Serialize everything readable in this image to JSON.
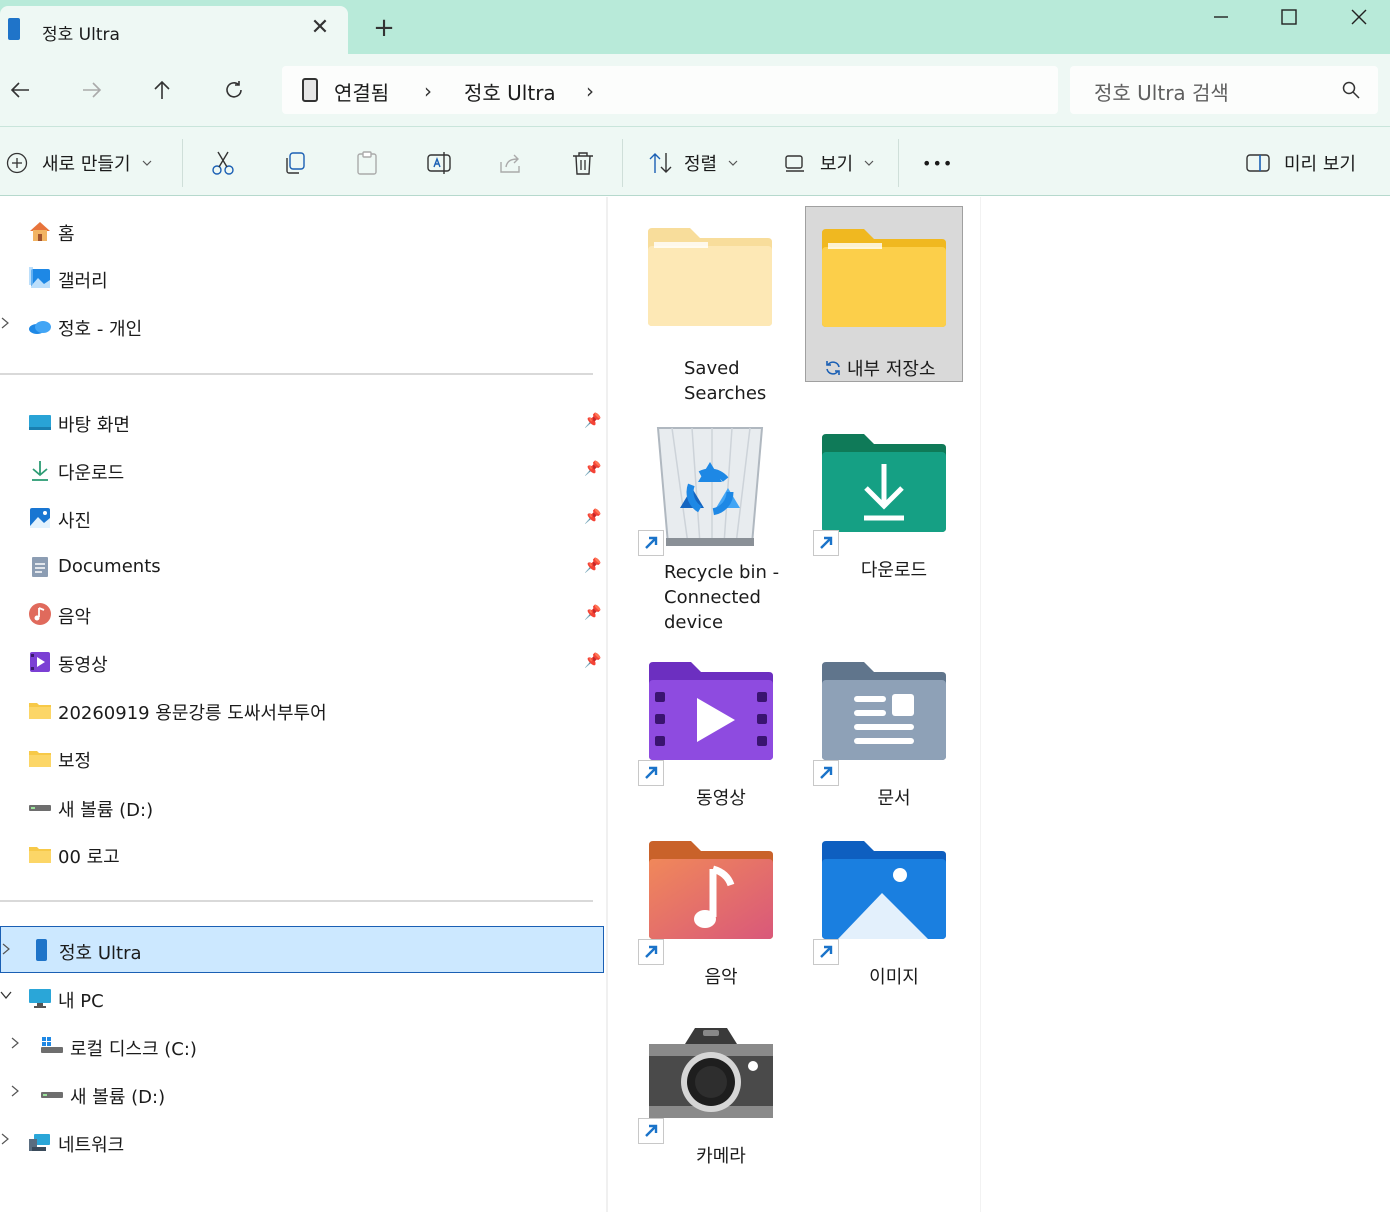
{
  "tab": {
    "title": "정호 Ultra",
    "close": "✕",
    "new": "+"
  },
  "window": {
    "minimize": "—",
    "maximize": "☐",
    "close": "✕"
  },
  "address": {
    "segments": [
      "연결됨",
      "정호 Ultra"
    ],
    "chevron": "›"
  },
  "search": {
    "placeholder": "정호 Ultra 검색"
  },
  "toolbar": {
    "new_label": "새로 만들기",
    "sort_label": "정렬",
    "view_label": "보기",
    "more": "•••",
    "preview_label": "미리 보기"
  },
  "sidebar": {
    "quick": [
      "홈",
      "갤러리",
      "정호 - 개인"
    ],
    "pinned": [
      "바탕 화면",
      "다운로드",
      "사진",
      "Documents",
      "음악",
      "동영상",
      "20260919 용문강릉 도싸서부투어",
      "보정",
      "새 볼륨 (D:)",
      "00 로고"
    ],
    "devices": [
      "정호 Ultra",
      "내 PC",
      "로컬 디스크 (C:)",
      "새 볼륨 (D:)",
      "네트워크"
    ]
  },
  "content": {
    "items": [
      {
        "label_line1": "Saved",
        "label_line2": "Searches"
      },
      {
        "label": "내부 저장소"
      },
      {
        "label_line1": "Recycle bin -",
        "label_line2": "Connected",
        "label_line3": "device"
      },
      {
        "label": "다운로드"
      },
      {
        "label": "동영상"
      },
      {
        "label": "문서"
      },
      {
        "label": "음악"
      },
      {
        "label": "이미지"
      },
      {
        "label": "카메라"
      }
    ]
  },
  "colors": {
    "accent": "#1a5fb4",
    "titlebar": "#b8ead9",
    "toolbar": "#eef8f4",
    "selection": "#cce8ff"
  }
}
